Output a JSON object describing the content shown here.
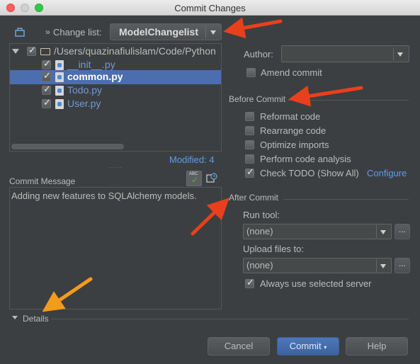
{
  "window": {
    "title": "Commit Changes"
  },
  "changelist": {
    "label": "Change list:",
    "value": "ModelChangelist"
  },
  "tree": {
    "root": "/Users/quazinafiulislam/Code/Python",
    "files": [
      {
        "name": "__init__.py"
      },
      {
        "name": "common.py"
      },
      {
        "name": "Todo.py"
      },
      {
        "name": "User.py"
      }
    ]
  },
  "modified": "Modified: 4",
  "commit_message": {
    "label": "Commit Message",
    "text": "Adding new features to SQLAlchemy models."
  },
  "details_label": "Details",
  "author": {
    "label": "Author:",
    "value": ""
  },
  "amend": {
    "label": "Amend commit"
  },
  "before_commit": {
    "title": "Before Commit",
    "options": [
      {
        "label": "Reformat code",
        "checked": false
      },
      {
        "label": "Rearrange code",
        "checked": false
      },
      {
        "label": "Optimize imports",
        "checked": false
      },
      {
        "label": "Perform code analysis",
        "checked": false
      },
      {
        "label": "Check TODO (Show All)",
        "checked": true
      }
    ],
    "configure_link": "Configure"
  },
  "after_commit": {
    "title": "After Commit",
    "run_tool_label": "Run tool:",
    "run_tool_value": "(none)",
    "upload_label": "Upload files to:",
    "upload_value": "(none)",
    "always_use_label": "Always use selected server",
    "more_label": "..."
  },
  "buttons": {
    "cancel": "Cancel",
    "commit": "Commit",
    "help": "Help"
  },
  "colors": {
    "background": "#3c3f41",
    "selection": "#4b6eaf",
    "link": "#589df6",
    "arrow_red": "#e8401c",
    "arrow_orange": "#f39c1b"
  }
}
